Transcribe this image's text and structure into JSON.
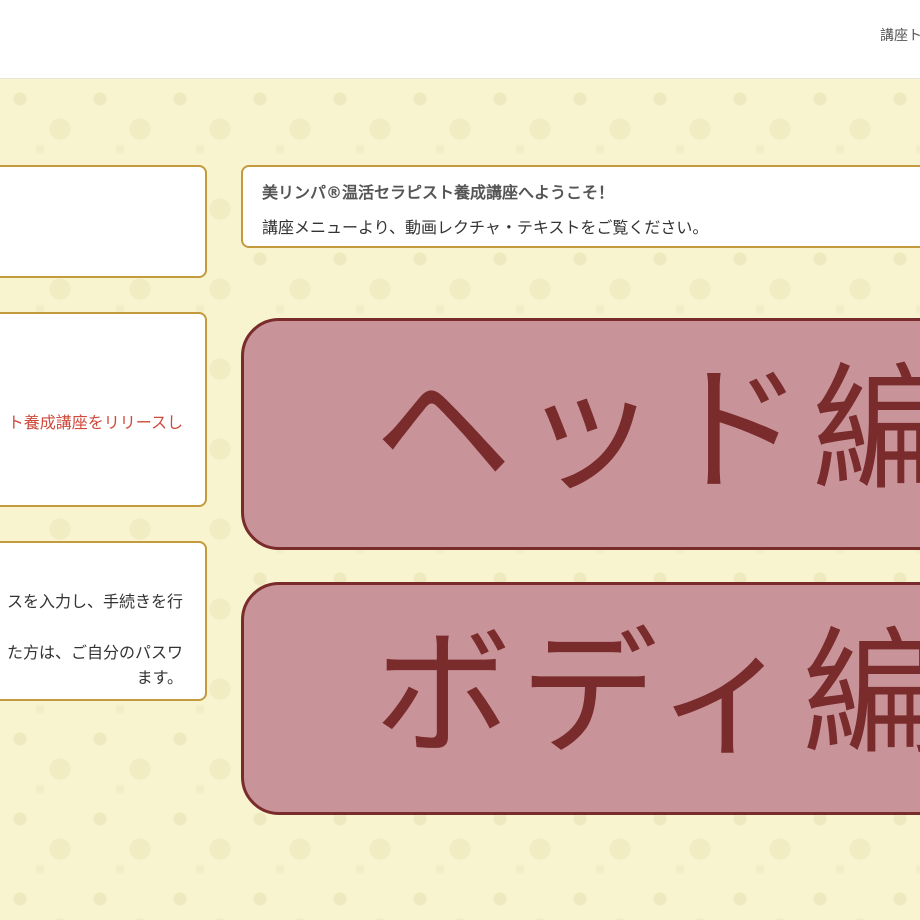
{
  "header": {
    "nav_link": "講座ト"
  },
  "left_cards": {
    "card2": {
      "line1": "ト養成講座をリリースし"
    },
    "card3": {
      "line1": "スを入力し、手続きを行",
      "line2": "た方は、ご自分のパスワ",
      "line3": "ます。"
    }
  },
  "welcome": {
    "title": "美リンパ®温活セラピスト養成講座へようこそ！",
    "body": "講座メニューより、動画レクチャ・テキストをご覧ください。"
  },
  "menu_buttons": [
    {
      "label": "ヘッド編"
    },
    {
      "label": "ボディ編"
    }
  ],
  "colors": {
    "background": "#f8f4cf",
    "card_border": "#c39a3e",
    "button_fill": "#c8949a",
    "button_text": "#7a2b2b",
    "highlight_text": "#cf4a3c"
  }
}
